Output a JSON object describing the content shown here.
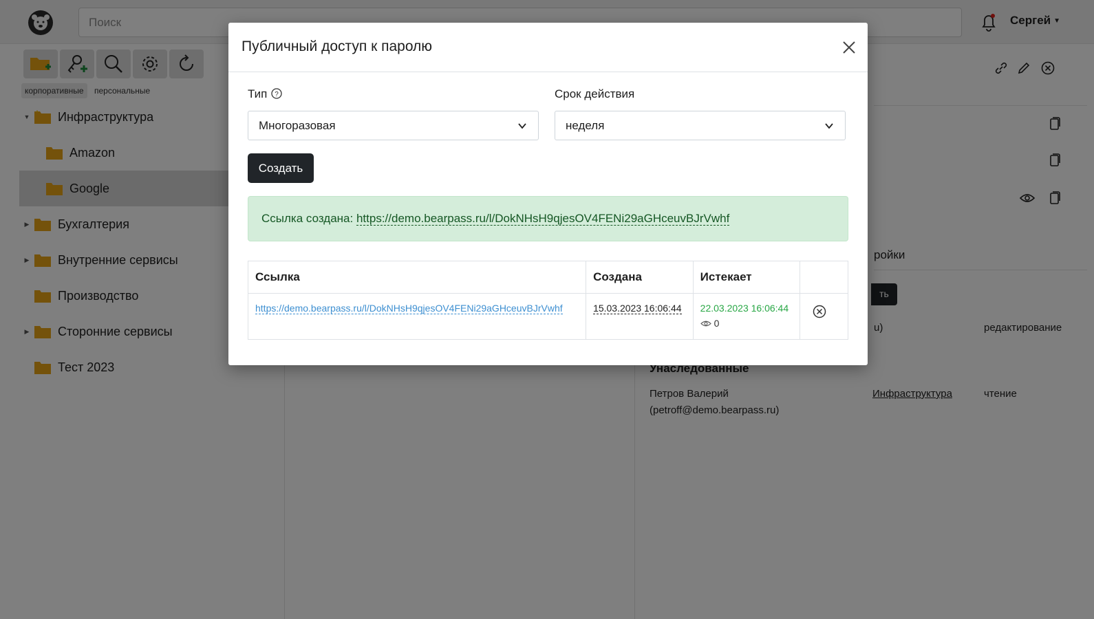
{
  "topbar": {
    "search_placeholder": "Поиск",
    "user_name": "Сергей"
  },
  "sidebar": {
    "tabs": [
      "корпоративные",
      "персональные"
    ],
    "tree": [
      {
        "label": "Инфраструктура",
        "expanded": true
      },
      {
        "label": "Amazon"
      },
      {
        "label": "Google",
        "selected": true
      },
      {
        "label": "Бухгалтерия",
        "expandable": true
      },
      {
        "label": "Внутренние сервисы",
        "expandable": true
      },
      {
        "label": "Производство"
      },
      {
        "label": "Сторонние сервисы",
        "expandable": true
      },
      {
        "label": "Тест 2023"
      }
    ]
  },
  "background": {
    "tab_partial": "ройки",
    "button_partial": "ть",
    "row_partial": "u)",
    "row_access": "редактирование",
    "inherited_title": "Унаследованные",
    "inherited_user_name": "Петров Валерий",
    "inherited_user_email": "(petroff@demo.bearpass.ru)",
    "inherited_folder": "Инфраструктура",
    "inherited_access": "чтение"
  },
  "modal": {
    "title": "Публичный доступ к паролю",
    "type_label": "Тип",
    "type_value": "Многоразовая",
    "validity_label": "Срок действия",
    "validity_value": "неделя",
    "create_button": "Создать",
    "alert_prefix": "Ссылка создана:",
    "alert_link": "https://demo.bearpass.ru/l/DokNHsH9qjesOV4FENi29aGHceuvBJrVwhf",
    "table": {
      "headers": [
        "Ссылка",
        "Создана",
        "Истекает",
        ""
      ],
      "rows": [
        {
          "link": "https://demo.bearpass.ru/l/DokNHsH9qjesOV4FENi29aGHceuvBJrVwhf",
          "created": "15.03.2023 16:06:44",
          "expires": "22.03.2023 16:06:44",
          "views": "0"
        }
      ]
    }
  },
  "colors": {
    "accent_dark": "#212529",
    "alert_bg": "#d4edda",
    "alert_text": "#155724",
    "link_blue": "#3d8fd1",
    "expire_green": "#28a745",
    "folder": "#e9a417"
  }
}
